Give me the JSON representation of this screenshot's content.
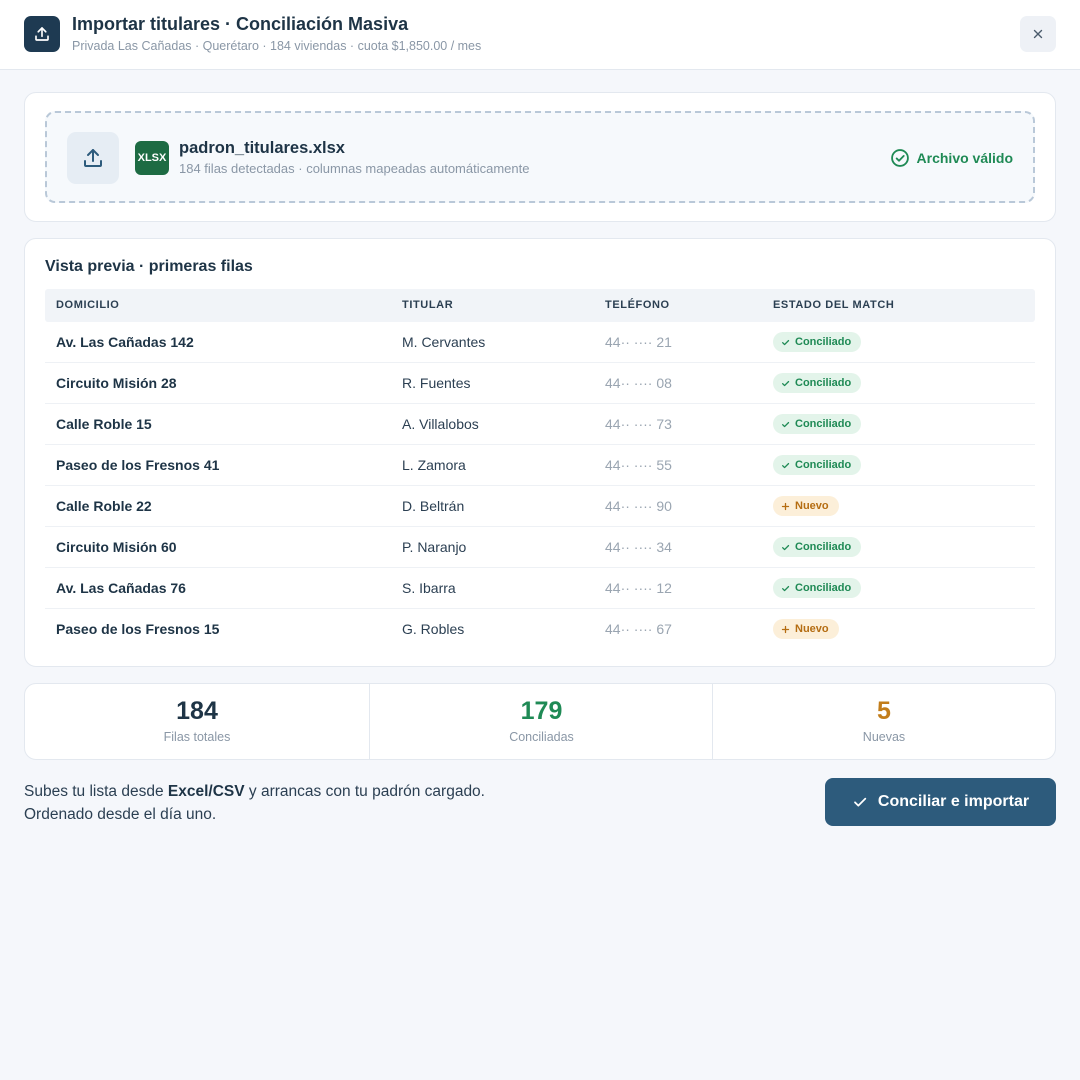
{
  "header": {
    "title": "Importar titulares · Conciliación Masiva",
    "subtitle": "Privada Las Cañadas · Querétaro · 184 viviendas · cuota $1,850.00 / mes",
    "icon": "upload-icon",
    "close_icon": "close-icon"
  },
  "file": {
    "badge": "XLSX",
    "name": "padron_titulares.xlsx",
    "meta": "184 filas detectadas · columnas mapeadas automáticamente",
    "status": "Archivo válido",
    "status_color": "#1f8a55"
  },
  "preview": {
    "title": "Vista previa · primeras filas",
    "columns": {
      "domicilio": "DOMICILIO",
      "titular": "TITULAR",
      "telefono": "TELÉFONO",
      "estado": "ESTADO DEL MATCH"
    },
    "rows": [
      {
        "domicilio": "Av. Las Cañadas 142",
        "titular": "M. Cervantes",
        "telefono": "44·· ···· 21",
        "estado": "Conciliado",
        "tipo": "ok"
      },
      {
        "domicilio": "Circuito Misión 28",
        "titular": "R. Fuentes",
        "telefono": "44·· ···· 08",
        "estado": "Conciliado",
        "tipo": "ok"
      },
      {
        "domicilio": "Calle Roble 15",
        "titular": "A. Villalobos",
        "telefono": "44·· ···· 73",
        "estado": "Conciliado",
        "tipo": "ok"
      },
      {
        "domicilio": "Paseo de los Fresnos 41",
        "titular": "L. Zamora",
        "telefono": "44·· ···· 55",
        "estado": "Conciliado",
        "tipo": "ok"
      },
      {
        "domicilio": "Calle Roble 22",
        "titular": "D. Beltrán",
        "telefono": "44·· ···· 90",
        "estado": "Nuevo",
        "tipo": "new"
      },
      {
        "domicilio": "Circuito Misión 60",
        "titular": "P. Naranjo",
        "telefono": "44·· ···· 34",
        "estado": "Conciliado",
        "tipo": "ok"
      },
      {
        "domicilio": "Av. Las Cañadas 76",
        "titular": "S. Ibarra",
        "telefono": "44·· ···· 12",
        "estado": "Conciliado",
        "tipo": "ok"
      },
      {
        "domicilio": "Paseo de los Fresnos 15",
        "titular": "G. Robles",
        "telefono": "44·· ···· 67",
        "estado": "Nuevo",
        "tipo": "new"
      }
    ]
  },
  "stats": [
    {
      "value": "184",
      "label": "Filas totales",
      "color": "#1e3446"
    },
    {
      "value": "179",
      "label": "Conciliadas",
      "color": "#1f8a55"
    },
    {
      "value": "5",
      "label": "Nuevas",
      "color": "#c27d1a"
    }
  ],
  "footer": {
    "text_before": "Subes tu lista desde ",
    "text_bold": "Excel/CSV",
    "text_after": " y arrancas con tu padrón cargado.",
    "line2": "Ordenado desde el día uno.",
    "button_label": "Conciliar e importar"
  },
  "colors": {
    "accent": "#2d5b7c",
    "ok": "#1f8a55",
    "new": "#b56d12"
  }
}
